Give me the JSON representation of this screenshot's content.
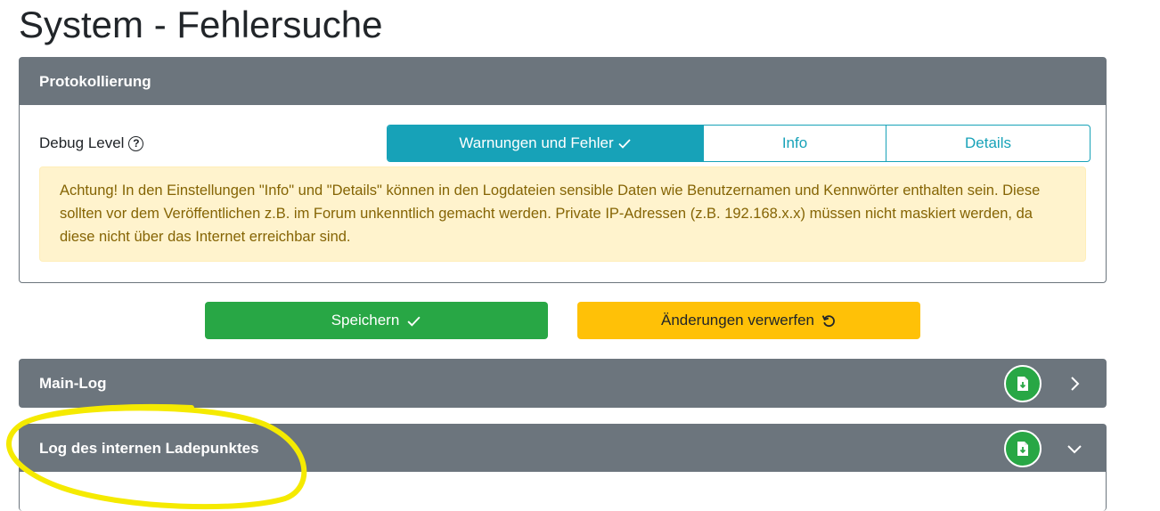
{
  "page": {
    "title": "System - Fehlersuche"
  },
  "protokoll": {
    "header": "Protokollierung",
    "debug_label": "Debug Level",
    "help_icon": "?",
    "options": [
      {
        "label": "Warnungen und Fehler",
        "selected": true
      },
      {
        "label": "Info",
        "selected": false
      },
      {
        "label": "Details",
        "selected": false
      }
    ],
    "warning_text": "Achtung! In den Einstellungen \"Info\" und \"Details\" können in den Logdateien sensible Daten wie Benutzernamen und Kennwörter enthalten sein. Diese sollten vor dem Veröffentlichen z.B. im Forum unkenntlich gemacht werden. Private IP-Adressen (z.B. 192.168.x.x) müssen nicht maskiert werden, da diese nicht über das Internet erreichbar sind."
  },
  "actions": {
    "save_label": "Speichern",
    "discard_label": "Änderungen verwerfen"
  },
  "logs": [
    {
      "title": "Main-Log",
      "download_icon": "file-download-icon",
      "expand_icon": "chevron-right-icon",
      "expanded": false
    },
    {
      "title": "Log des internen Ladepunktes",
      "download_icon": "file-download-icon",
      "expand_icon": "chevron-down-icon",
      "expanded": true
    }
  ],
  "colors": {
    "header_bg": "#6c757d",
    "info": "#17a2b8",
    "success": "#28a745",
    "warning": "#ffc107",
    "alert_bg": "#fff3cd",
    "alert_text": "#856404",
    "highlight": "#f5ea00"
  }
}
